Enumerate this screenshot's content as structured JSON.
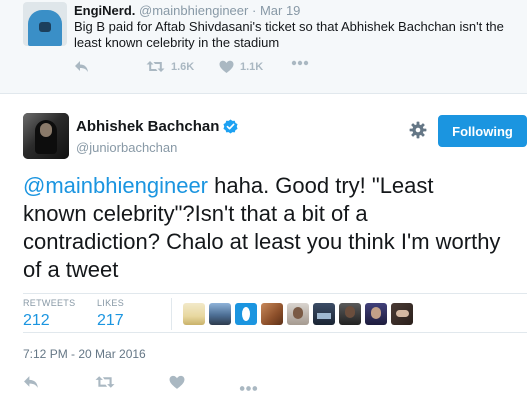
{
  "parent_tweet": {
    "name": "EngiNerd.",
    "handle": "@mainbhiengineer",
    "separator": "·",
    "date": "Mar 19",
    "text": "Big B paid for Aftab Shivdasani's ticket so that Abhishek Bachchan isn't the least known celebrity in the stadium",
    "actions": {
      "retweet_count": "1.6K",
      "like_count": "1.1K"
    }
  },
  "main_tweet": {
    "name": "Abhishek Bachchan",
    "handle": "@juniorbachchan",
    "follow_label": "Following",
    "mention": "@mainbhiengineer",
    "text": " haha. Good try! \"Least known celebrity\"?Isn't that a bit of a contradiction? Chalo at least you think I'm worthy of a tweet",
    "retweets_label": "RETWEETS",
    "retweets_value": "212",
    "likes_label": "LIKES",
    "likes_value": "217",
    "timestamp": "7:12 PM - 20 Mar 2016"
  },
  "icons": {
    "reply": "reply-icon",
    "retweet": "retweet-icon",
    "like": "heart-icon",
    "more": "more-icon",
    "settings": "gear-icon",
    "verified": "verified-badge-icon"
  },
  "colors": {
    "accent": "#1b95e0",
    "muted": "#8899a6",
    "action_gray": "#aab8c2",
    "parent_bg": "#f5f8fa"
  }
}
